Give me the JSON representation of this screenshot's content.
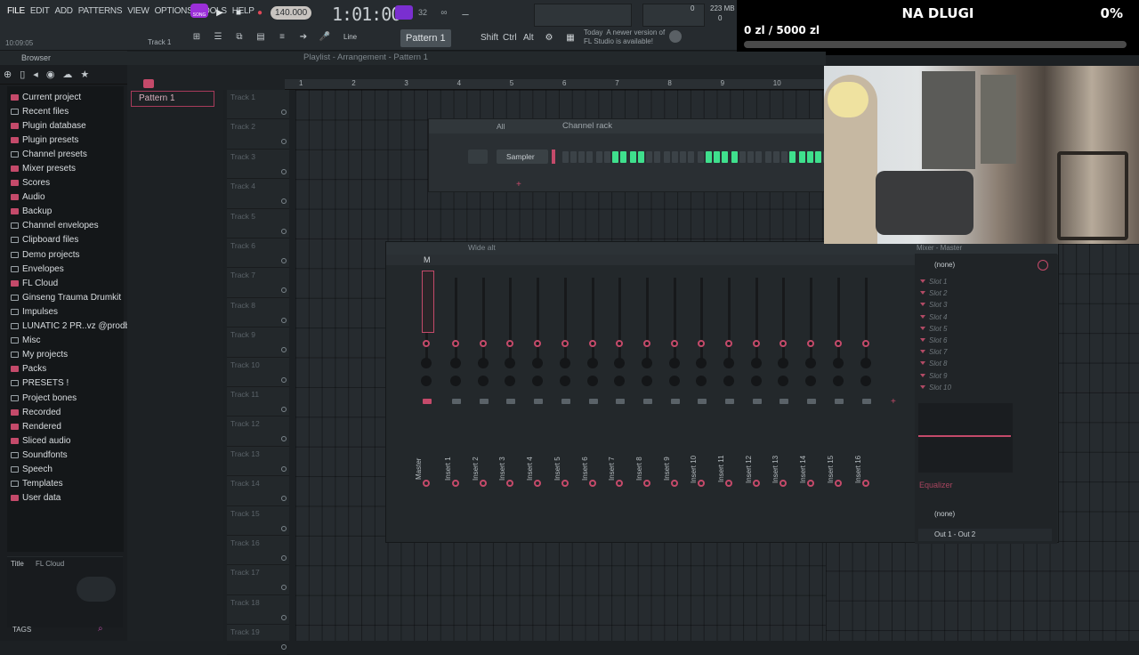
{
  "menu": [
    "FILE",
    "EDIT",
    "ADD",
    "PATTERNS",
    "VIEW",
    "OPTIONS",
    "TOOLS",
    "HELP"
  ],
  "toolbar": {
    "mode_badge": "SONG",
    "tempo": "140.000",
    "time": "1:01:00",
    "memory": "223 MB",
    "cpu": "0",
    "voices": "0",
    "pattern": "Pattern 1",
    "snap": "Line",
    "hint_date": "Today",
    "hint_text_1": "A newer version of",
    "hint_text_2": "FL Studio is available!",
    "shift": "Shift",
    "ctrl": "Ctrl",
    "alt": "Alt",
    "track_label": "Track 1",
    "clock": "10:09:05"
  },
  "browser": {
    "title": "Browser",
    "items": [
      {
        "label": "Current project",
        "icon": "folder-pink-icon"
      },
      {
        "label": "Recent files",
        "icon": "folder-icon"
      },
      {
        "label": "Plugin database",
        "icon": "plugin-icon"
      },
      {
        "label": "Plugin presets",
        "icon": "plugin-icon"
      },
      {
        "label": "Channel presets",
        "icon": "folder-icon"
      },
      {
        "label": "Mixer presets",
        "icon": "plugin-icon"
      },
      {
        "label": "Scores",
        "icon": "note-icon"
      },
      {
        "label": "Audio",
        "icon": "audio-icon"
      },
      {
        "label": "Backup",
        "icon": "folder-pink-icon"
      },
      {
        "label": "Channel envelopes",
        "icon": "folder-icon"
      },
      {
        "label": "Clipboard files",
        "icon": "folder-icon"
      },
      {
        "label": "Demo projects",
        "icon": "folder-icon"
      },
      {
        "label": "Envelopes",
        "icon": "folder-icon"
      },
      {
        "label": "FL Cloud",
        "icon": "cloud-icon"
      },
      {
        "label": "Ginseng Trauma Drumkit",
        "icon": "folder-icon"
      },
      {
        "label": "Impulses",
        "icon": "folder-icon"
      },
      {
        "label": "LUNATIC 2 PR..vz @prodbufu",
        "icon": "folder-icon"
      },
      {
        "label": "Misc",
        "icon": "folder-icon"
      },
      {
        "label": "My projects",
        "icon": "folder-icon"
      },
      {
        "label": "Packs",
        "icon": "folder-pink-icon"
      },
      {
        "label": "PRESETS !",
        "icon": "folder-icon"
      },
      {
        "label": "Project bones",
        "icon": "folder-icon"
      },
      {
        "label": "Recorded",
        "icon": "folder-pink-icon"
      },
      {
        "label": "Rendered",
        "icon": "folder-pink-icon"
      },
      {
        "label": "Sliced audio",
        "icon": "folder-pink-icon"
      },
      {
        "label": "Soundfonts",
        "icon": "folder-icon"
      },
      {
        "label": "Speech",
        "icon": "folder-icon"
      },
      {
        "label": "Templates",
        "icon": "folder-icon"
      },
      {
        "label": "User data",
        "icon": "user-icon"
      }
    ],
    "footer_title": "Title",
    "footer_value": "FL Cloud",
    "tags": "TAGS"
  },
  "playlist": {
    "title": "Playlist - Arrangement",
    "pattern": "Pattern 1",
    "pattern_item": "Pattern 1",
    "ruler": [
      "1",
      "2",
      "3",
      "4",
      "5",
      "6",
      "7",
      "8",
      "9",
      "10"
    ],
    "tracks": [
      "Track 1",
      "Track 2",
      "Track 3",
      "Track 4",
      "Track 5",
      "Track 6",
      "Track 7",
      "Track 8",
      "Track 9",
      "Track 10",
      "Track 11",
      "Track 12",
      "Track 13",
      "Track 14",
      "Track 15",
      "Track 16",
      "Track 17",
      "Track 18",
      "Track 19"
    ]
  },
  "channel_rack": {
    "filter": "All",
    "title": "Channel rack",
    "channel": "Sampler",
    "steps": [
      0,
      0,
      0,
      0,
      0,
      0,
      1,
      1,
      1,
      1,
      0,
      0,
      0,
      0,
      0,
      0,
      0,
      1,
      1,
      1,
      1,
      0,
      0,
      0,
      0,
      0,
      0,
      1,
      1,
      1,
      1,
      0
    ]
  },
  "mixer": {
    "title": "Wide alt",
    "panel_title": "Mixer - Master",
    "master_label": "M",
    "strips": [
      "Master",
      "Insert 1",
      "Insert 2",
      "Insert 3",
      "Insert 4",
      "Insert 5",
      "Insert 6",
      "Insert 7",
      "Insert 8",
      "Insert 9",
      "Insert 10",
      "Insert 11",
      "Insert 12",
      "Insert 13",
      "Insert 14",
      "Insert 15",
      "Insert 16"
    ],
    "input": "(none)",
    "slots": [
      "Slot 1",
      "Slot 2",
      "Slot 3",
      "Slot 4",
      "Slot 5",
      "Slot 6",
      "Slot 7",
      "Slot 8",
      "Slot 9",
      "Slot 10"
    ],
    "eq": "Equalizer",
    "output_in": "(none)",
    "output": "Out 1 - Out 2"
  },
  "goal": {
    "title": "NA DLUGI",
    "amount": "0 zl / 5000 zl",
    "percent_label": "0%",
    "progress": 0
  },
  "colors": {
    "accent": "#c44a6a",
    "step_on": "#3fe08d"
  }
}
